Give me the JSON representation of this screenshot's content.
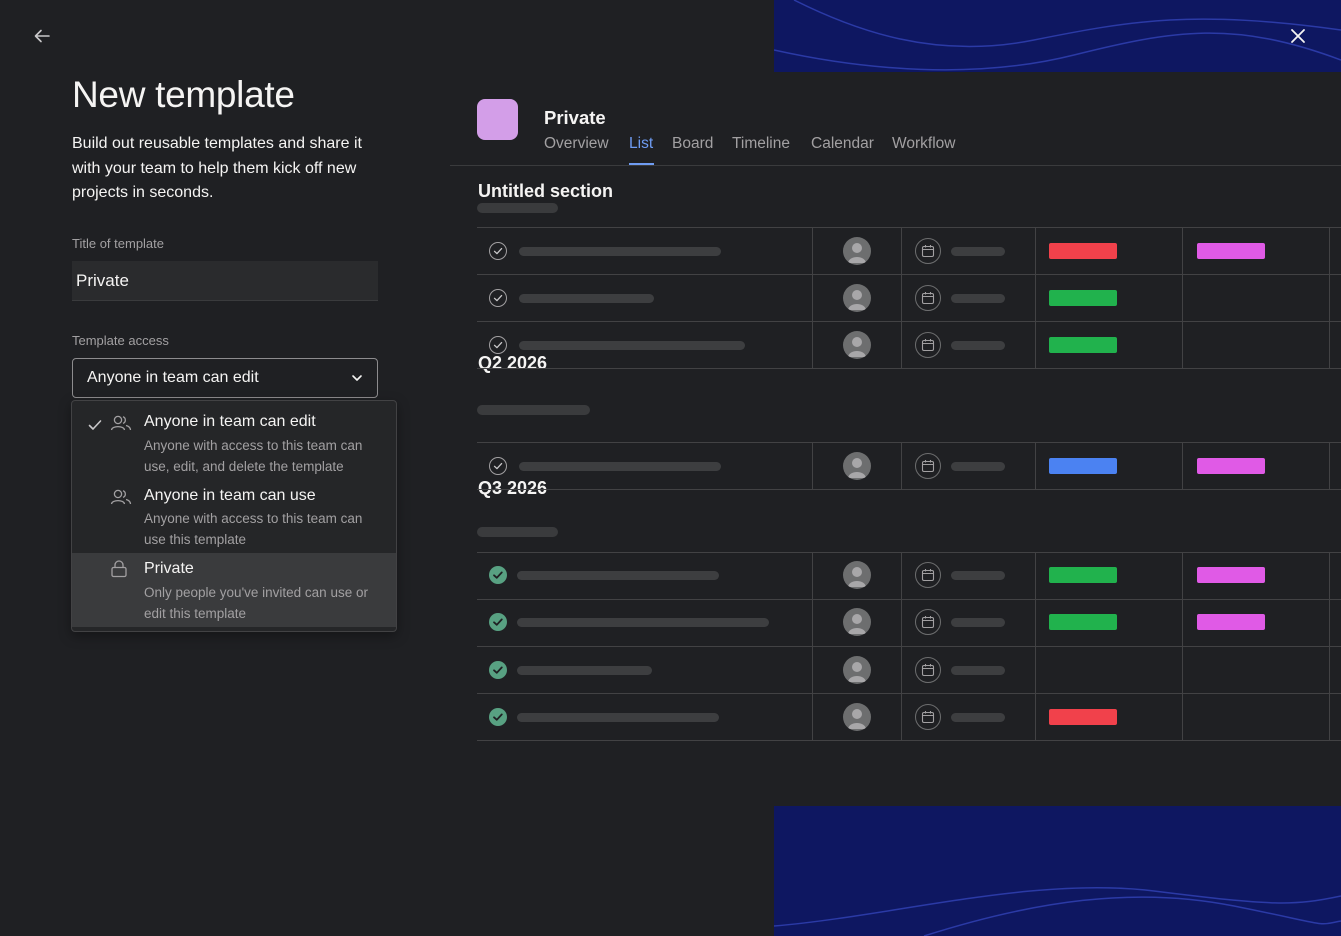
{
  "header": {
    "back_icon": "arrow-left-icon",
    "close_icon": "close-icon"
  },
  "left": {
    "title": "New template",
    "description": "Build out reusable templates and share it with your team to help them kick off new projects in seconds.",
    "title_field": {
      "label": "Title of template",
      "value": "Private"
    },
    "access": {
      "label": "Template access",
      "selected": "Anyone in team can edit",
      "options": [
        {
          "title": "Anyone in team can edit",
          "description": "Anyone with access to this team can use, edit, and delete the template",
          "icon": "people-icon",
          "checked": true,
          "highlighted": false
        },
        {
          "title": "Anyone in team can use",
          "description": "Anyone with access to this team can use this template",
          "icon": "people-icon",
          "checked": false,
          "highlighted": false
        },
        {
          "title": "Private",
          "description": "Only people you've invited can use or edit this template",
          "icon": "lock-icon",
          "checked": false,
          "highlighted": true
        }
      ]
    }
  },
  "preview": {
    "project_name": "Private",
    "project_color": "#d39ee8",
    "tabs": [
      "Overview",
      "List",
      "Board",
      "Timeline",
      "Calendar",
      "Workflow"
    ],
    "active_tab": "List",
    "sections": [
      "Untitled section",
      "Q2 2026",
      "Q3 2026"
    ],
    "colors": {
      "red": "#f1414b",
      "green": "#21b24d",
      "blue": "#4b82f2",
      "magenta": "#e05ae6",
      "done": "#58a182"
    }
  }
}
